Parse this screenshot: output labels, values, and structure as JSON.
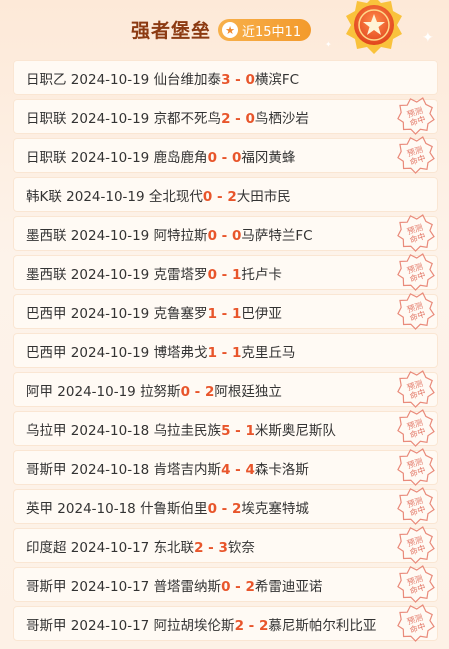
{
  "header": {
    "title": "强者堡垒",
    "badge": "近15中11"
  },
  "stamp_text": [
    "预测",
    "命中"
  ],
  "matches": [
    {
      "league": "日职乙",
      "date": "2024-10-19",
      "home": "仙台维加泰",
      "hs": "3",
      "as": "0",
      "away": "横滨FC",
      "hit": false
    },
    {
      "league": "日职联",
      "date": "2024-10-19",
      "home": "京都不死鸟",
      "hs": "2",
      "as": "0",
      "away": "鸟栖沙岩",
      "hit": true
    },
    {
      "league": "日职联",
      "date": "2024-10-19",
      "home": "鹿岛鹿角",
      "hs": "0",
      "as": "0",
      "away": "福冈黄蜂",
      "hit": true
    },
    {
      "league": "韩K联",
      "date": "2024-10-19",
      "home": "全北现代",
      "hs": "0",
      "as": "2",
      "away": "大田市民",
      "hit": false
    },
    {
      "league": "墨西联",
      "date": "2024-10-19",
      "home": "阿特拉斯",
      "hs": "0",
      "as": "0",
      "away": "马萨特兰FC",
      "hit": true
    },
    {
      "league": "墨西联",
      "date": "2024-10-19",
      "home": "克雷塔罗",
      "hs": "0",
      "as": "1",
      "away": "托卢卡",
      "hit": true
    },
    {
      "league": "巴西甲",
      "date": "2024-10-19",
      "home": "克鲁塞罗",
      "hs": "1",
      "as": "1",
      "away": "巴伊亚",
      "hit": true
    },
    {
      "league": "巴西甲",
      "date": "2024-10-19",
      "home": "博塔弗戈",
      "hs": "1",
      "as": "1",
      "away": "克里丘马",
      "hit": false
    },
    {
      "league": "阿甲",
      "date": "2024-10-19",
      "home": "拉努斯",
      "hs": "0",
      "as": "2",
      "away": "阿根廷独立",
      "hit": true
    },
    {
      "league": "乌拉甲",
      "date": "2024-10-18",
      "home": "乌拉圭民族",
      "hs": "5",
      "as": "1",
      "away": "米斯奥尼斯队",
      "hit": true
    },
    {
      "league": "哥斯甲",
      "date": "2024-10-18",
      "home": "肯塔吉内斯",
      "hs": "4",
      "as": "4",
      "away": "森卡洛斯",
      "hit": true
    },
    {
      "league": "英甲",
      "date": "2024-10-18",
      "home": "什鲁斯伯里",
      "hs": "0",
      "as": "2",
      "away": "埃克塞特城",
      "hit": true
    },
    {
      "league": "印度超",
      "date": "2024-10-17",
      "home": "东北联",
      "hs": "2",
      "as": "3",
      "away": "钦奈",
      "hit": true
    },
    {
      "league": "哥斯甲",
      "date": "2024-10-17",
      "home": "普塔雷纳斯",
      "hs": "0",
      "as": "2",
      "away": "希雷迪亚诺",
      "hit": true
    },
    {
      "league": "哥斯甲",
      "date": "2024-10-17",
      "home": "阿拉胡埃伦斯",
      "hs": "2",
      "as": "2",
      "away": "慕尼斯帕尔利比亚",
      "hit": true
    }
  ]
}
